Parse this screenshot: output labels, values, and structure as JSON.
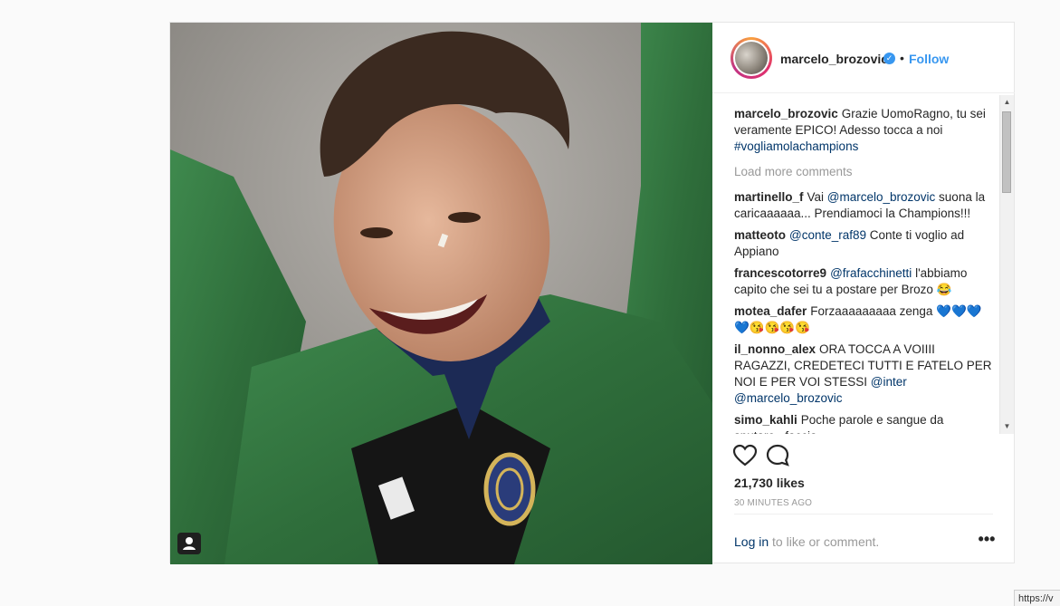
{
  "post": {
    "username": "marcelo_brozovic",
    "verified_icon": "verified-badge-icon",
    "dot": "•",
    "follow_label": "Follow",
    "caption": {
      "user": "marcelo_brozovic",
      "text": "Grazie UomoRagno, tu sei veramente EPICO! Adesso tocca a noi",
      "hashtag": "#vogliamolachampions"
    },
    "load_more": "Load more comments",
    "comments": [
      {
        "user": "martinello_f",
        "parts": [
          "Vai ",
          "@marcelo_brozovic",
          " suona la caricaaaaaa... Prendiamoci la Champions!!!"
        ]
      },
      {
        "user": "matteoto",
        "parts": [
          "",
          "@conte_raf89",
          " Conte ti voglio ad Appiano"
        ]
      },
      {
        "user": "francescotorre9",
        "parts": [
          "",
          "@frafacchinetti",
          " l'abbiamo capito che sei tu a postare per Brozo 😂"
        ]
      },
      {
        "user": "motea_dafer",
        "parts": [
          "Forzaaaaaaaaa zenga 💙💙💙💙😘😘😘😘",
          "",
          ""
        ]
      },
      {
        "user": "il_nonno_alex",
        "parts": [
          "ORA TOCCA A VOIIII RAGAZZI, CREDETECI TUTTI E FATELO PER NOI E PER VOI STESSI ",
          "@inter",
          ""
        ]
      },
      {
        "user": "",
        "parts": [
          "",
          "@marcelo_brozovic",
          ""
        ]
      },
      {
        "user": "simo_kahli",
        "parts": [
          "Poche parole e sangue da sputare...faccia",
          "",
          ""
        ]
      }
    ],
    "likes": "21,730 likes",
    "time": "30 MINUTES AGO",
    "login_link": "Log in",
    "login_rest": " to like or comment.",
    "more_options": "•••"
  },
  "icons": {
    "like": "heart-icon",
    "comment": "speech-bubble-icon",
    "tag": "user-tag-icon"
  },
  "status_bar": {
    "url": "https://v"
  }
}
